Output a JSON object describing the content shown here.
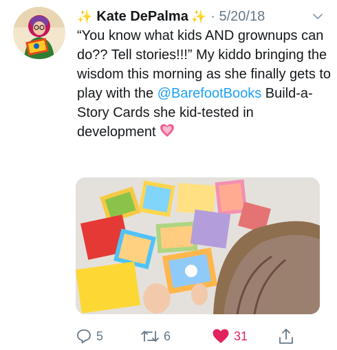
{
  "tweet": {
    "display_name": "Kate DePalma",
    "date": "5/20/18",
    "separator": " · ",
    "text_before_mention": "“You know what kids AND grownups can do?? Tell stories!!!” My kiddo bringing the wisdom this morning as she finally gets to play with the ",
    "mention": "@BarefootBooks",
    "text_after_mention": " Build-a-Story Cards she kid-tested in development ",
    "reply_count": "5",
    "retweet_count": "6",
    "like_count": "31"
  },
  "icons": {
    "name_decoration": "sparkles-emoji",
    "text_emoji": "growing-heart-emoji",
    "menu": "chevron-down-icon",
    "reply": "reply-icon",
    "retweet": "retweet-icon",
    "like": "heart-icon",
    "share": "share-icon"
  },
  "colors": {
    "link": "#1da1f2",
    "like_active": "#e0245e",
    "muted": "#657786"
  }
}
